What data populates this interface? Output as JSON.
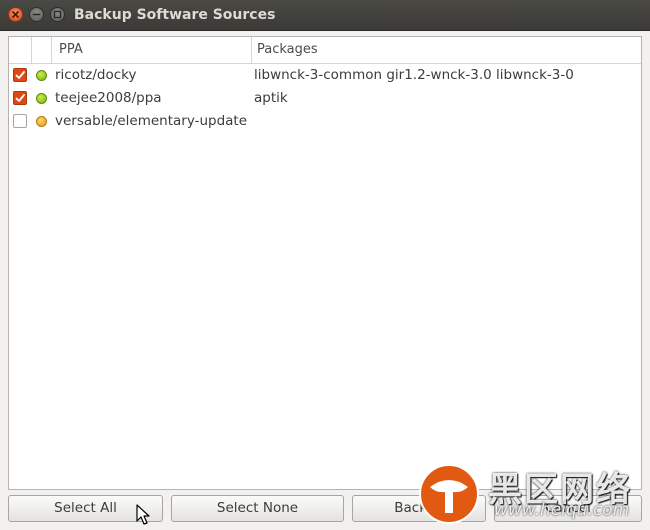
{
  "window": {
    "title": "Backup Software Sources"
  },
  "table": {
    "columns": [
      "PPA",
      "Packages"
    ],
    "rows": [
      {
        "checked": true,
        "status": "green",
        "ppa": "ricotz/docky",
        "packages": "libwnck-3-common gir1.2-wnck-3.0 libwnck-3-0"
      },
      {
        "checked": true,
        "status": "green",
        "ppa": "teejee2008/ppa",
        "packages": "aptik"
      },
      {
        "checked": false,
        "status": "orange",
        "ppa": "versable/elementary-update",
        "packages": ""
      }
    ]
  },
  "buttons": {
    "select_all": "Select All",
    "select_none": "Select None",
    "backup": "Backup",
    "cancel": "Cancel"
  },
  "watermark": {
    "text": "黑区网络",
    "url": "www.heiqu.com"
  },
  "colors": {
    "accent": "#dd4814",
    "status_green": "#8fc31f",
    "status_orange": "#f0a830",
    "titlebar": "#3c3b37"
  },
  "icons": {
    "close": "close-icon",
    "minimize": "minimize-icon",
    "maximize": "maximize-icon",
    "check": "checkmark-icon",
    "cursor": "mouse-pointer-icon"
  }
}
